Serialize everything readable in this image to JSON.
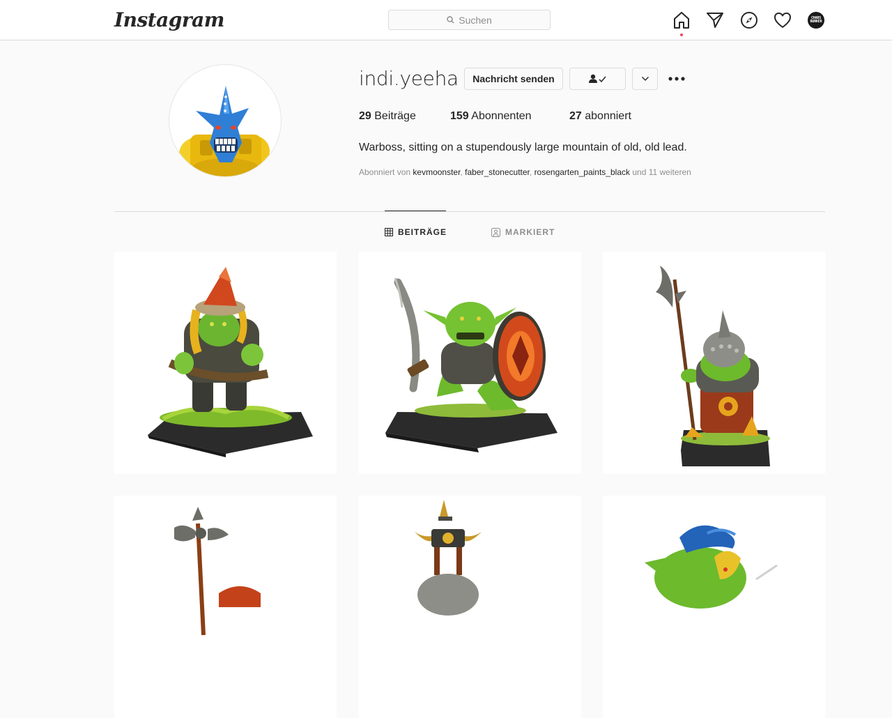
{
  "app": {
    "logo_text": "Instagram"
  },
  "search": {
    "placeholder": "Suchen"
  },
  "nav": {
    "icons": [
      "home-icon",
      "direct-icon",
      "explore-icon",
      "activity-icon",
      "profile-avatar"
    ],
    "avatar_text": "CHARS BUNKER"
  },
  "profile": {
    "username": "indi.yeeha",
    "message_button": "Nachricht senden",
    "stats": {
      "posts_count": "29",
      "posts_label": "Beiträge",
      "followers_count": "159",
      "followers_label": "Abonnenten",
      "following_count": "27",
      "following_label": "abonniert"
    },
    "bio": "Warboss, sitting on a stupendously large mountain of old, old lead.",
    "followed_by": {
      "prefix": "Abonniert von",
      "users": [
        "kevmoonster",
        "faber_stonecutter",
        "rosengarten_paints_black"
      ],
      "suffix": "und 11 weiteren"
    }
  },
  "tabs": {
    "posts": "BEITRÄGE",
    "tagged": "MARKIERT"
  },
  "colors": {
    "accent_dot": "#ed4956",
    "border": "#dbdbdb",
    "text": "#262626",
    "muted": "#8e8e8e"
  }
}
